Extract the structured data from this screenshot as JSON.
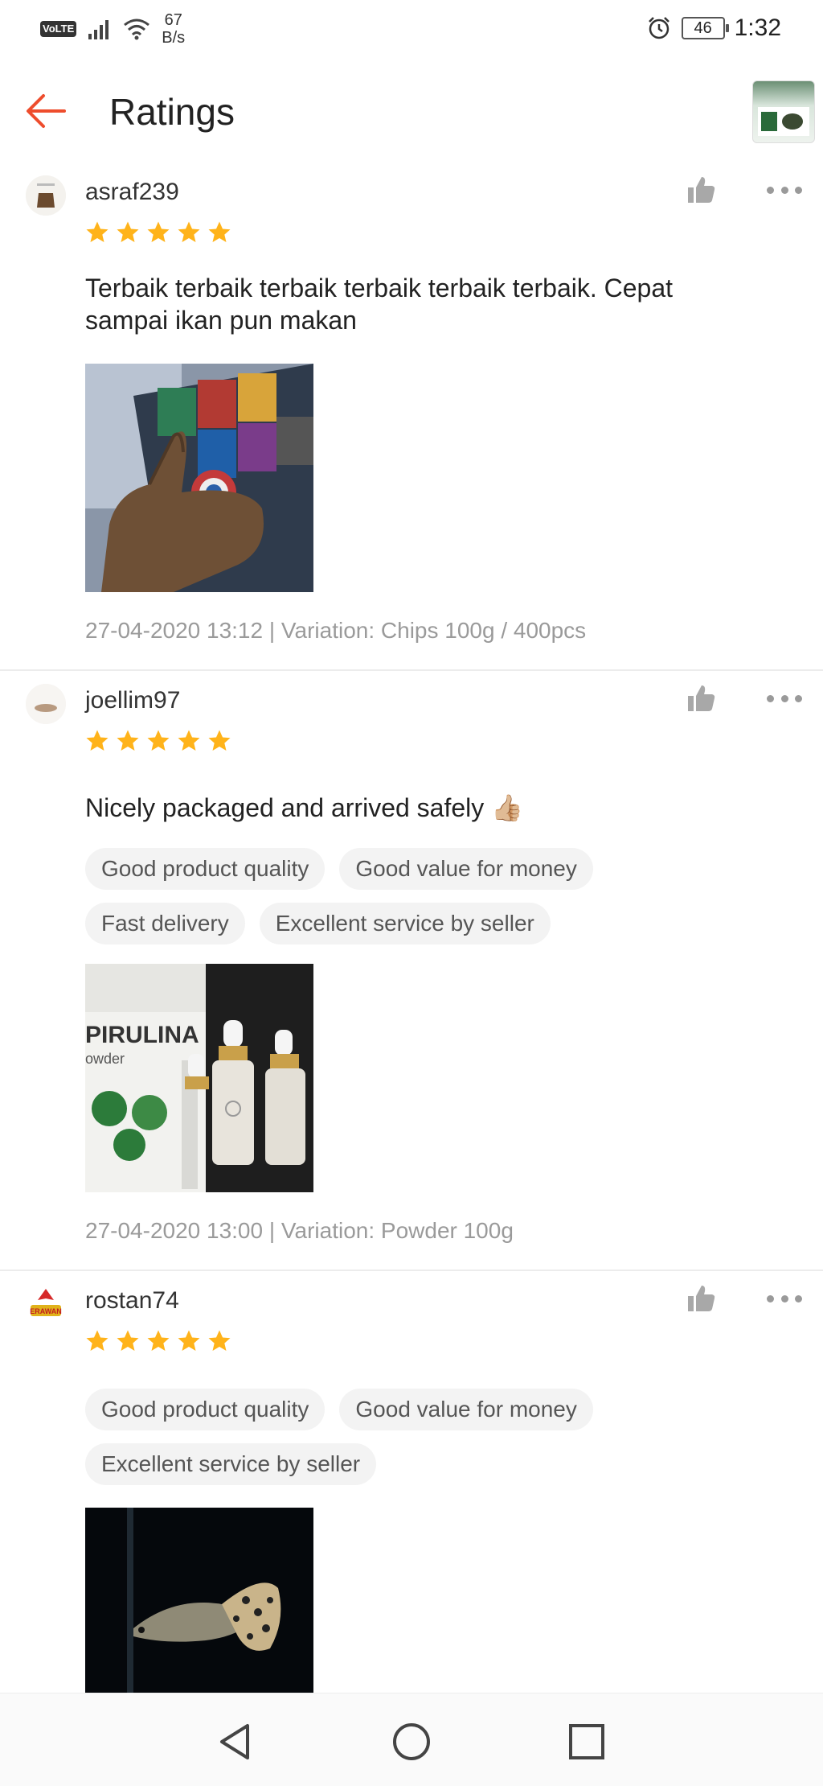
{
  "status_bar": {
    "volte": "VoLTE",
    "net_speed_value": "67",
    "net_speed_unit": "B/s",
    "battery": "46",
    "time": "1:32"
  },
  "header": {
    "title": "Ratings"
  },
  "reviews": [
    {
      "username": "asraf239",
      "rating": 5,
      "comment": "Terbaik terbaik terbaik terbaik terbaik terbaik. Cepat sampai ikan pun makan",
      "tags": [],
      "meta": "27-04-2020 13:12 | Variation: Chips 100g / 400pcs"
    },
    {
      "username": "joellim97",
      "rating": 5,
      "comment": "Nicely packaged and arrived safely 👍🏼",
      "tags": [
        "Good product quality",
        "Good value for money",
        "Fast delivery",
        "Excellent service by seller"
      ],
      "meta": "27-04-2020 13:00 | Variation: Powder 100g",
      "photo_text": "PIRULINA",
      "photo_subtext": "owder"
    },
    {
      "username": "rostan74",
      "rating": 5,
      "avatar_text": "ERAWAN",
      "tags": [
        "Good product quality",
        "Good value for money",
        "Excellent service by seller"
      ]
    }
  ],
  "colors": {
    "accent": "#ee4d2d",
    "star": "#ffb31a",
    "tag_bg": "#f3f3f3",
    "meta_text": "#9a9a9a"
  },
  "icons": {
    "back": "arrow-left-icon",
    "like": "thumbs-up-icon",
    "more": "more-horizontal-icon",
    "star": "star-icon",
    "nav_back": "triangle-back-icon",
    "nav_home": "circle-home-icon",
    "nav_recents": "square-recents-icon"
  }
}
